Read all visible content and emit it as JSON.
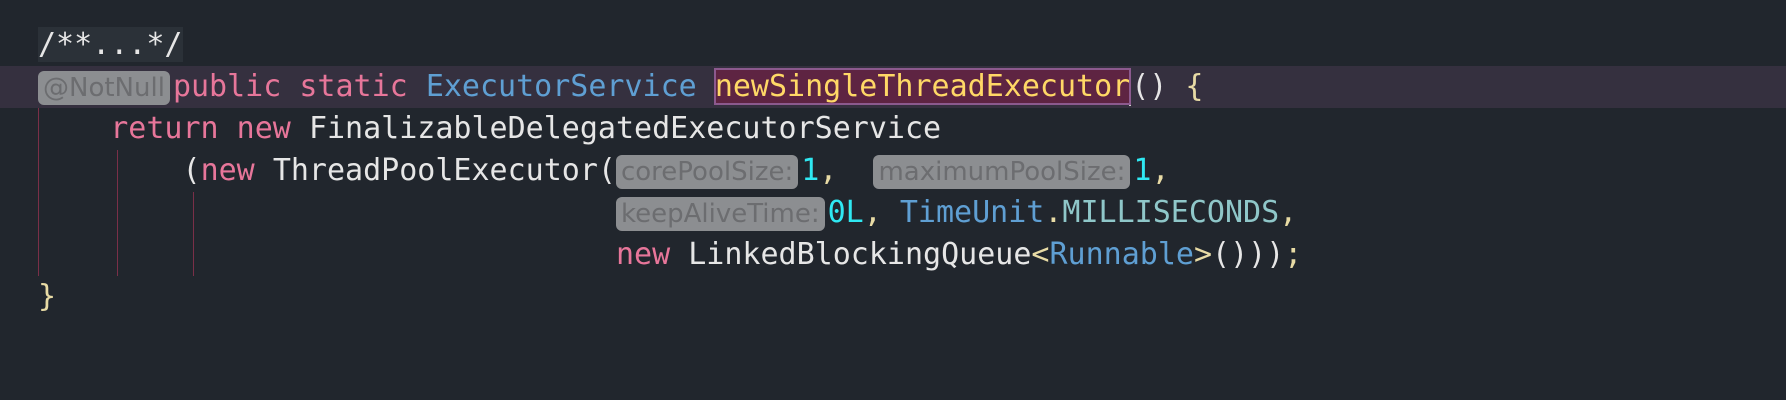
{
  "editor": {
    "language": "java",
    "colors": {
      "background": "#21262d",
      "keyword": "#e7769a",
      "type": "#5f9fd3",
      "method": "#ffd866",
      "number": "#2fe8f2",
      "punctuation": "#e8dba5",
      "hint_bg": "#8c8e91"
    },
    "lines": [
      {
        "tokens": [
          {
            "t": "/**...*/",
            "c": "plain fold"
          }
        ]
      },
      {
        "current": true,
        "tokens": [
          {
            "t": "@NotNull",
            "c": "hint"
          },
          {
            "t": "public static ",
            "c": "kw"
          },
          {
            "t": "ExecutorService",
            "c": "type"
          },
          {
            "t": " ",
            "c": "plain"
          },
          {
            "t": "newSingleThreadExecutor",
            "c": "method"
          },
          {
            "t": "",
            "c": "caret"
          },
          {
            "t": "() ",
            "c": "plain"
          },
          {
            "t": "{",
            "c": "punct"
          }
        ]
      },
      {
        "tokens": [
          {
            "t": "    ",
            "c": "plain"
          },
          {
            "t": "return new ",
            "c": "kw"
          },
          {
            "t": "FinalizableDelegatedExecutorService",
            "c": "plain"
          }
        ]
      },
      {
        "tokens": [
          {
            "t": "        (",
            "c": "plain"
          },
          {
            "t": "new ",
            "c": "kw"
          },
          {
            "t": "ThreadPoolExecutor(",
            "c": "plain"
          },
          {
            "t": "corePoolSize:",
            "c": "hint"
          },
          {
            "t": "1",
            "c": "num"
          },
          {
            "t": ",  ",
            "c": "punct"
          },
          {
            "t": "maximumPoolSize:",
            "c": "hint"
          },
          {
            "t": "1",
            "c": "num"
          },
          {
            "t": ",",
            "c": "punct"
          }
        ]
      },
      {
        "tokens": [
          {
            "t": "                                ",
            "c": "plain"
          },
          {
            "t": "keepAliveTime:",
            "c": "hint"
          },
          {
            "t": "0L",
            "c": "num"
          },
          {
            "t": ", ",
            "c": "punct"
          },
          {
            "t": "TimeUnit",
            "c": "type"
          },
          {
            "t": ".",
            "c": "punct"
          },
          {
            "t": "MILLISECONDS",
            "c": "const"
          },
          {
            "t": ",",
            "c": "punct"
          }
        ]
      },
      {
        "tokens": [
          {
            "t": "                                ",
            "c": "plain"
          },
          {
            "t": "new ",
            "c": "kw"
          },
          {
            "t": "LinkedBlockingQueue",
            "c": "plain"
          },
          {
            "t": "<",
            "c": "punct"
          },
          {
            "t": "Runnable",
            "c": "type"
          },
          {
            "t": ">",
            "c": "punct"
          },
          {
            "t": "()))",
            "c": "plain"
          },
          {
            "t": ";",
            "c": "punct"
          }
        ]
      },
      {
        "tokens": [
          {
            "t": "}",
            "c": "punct"
          }
        ]
      }
    ]
  }
}
